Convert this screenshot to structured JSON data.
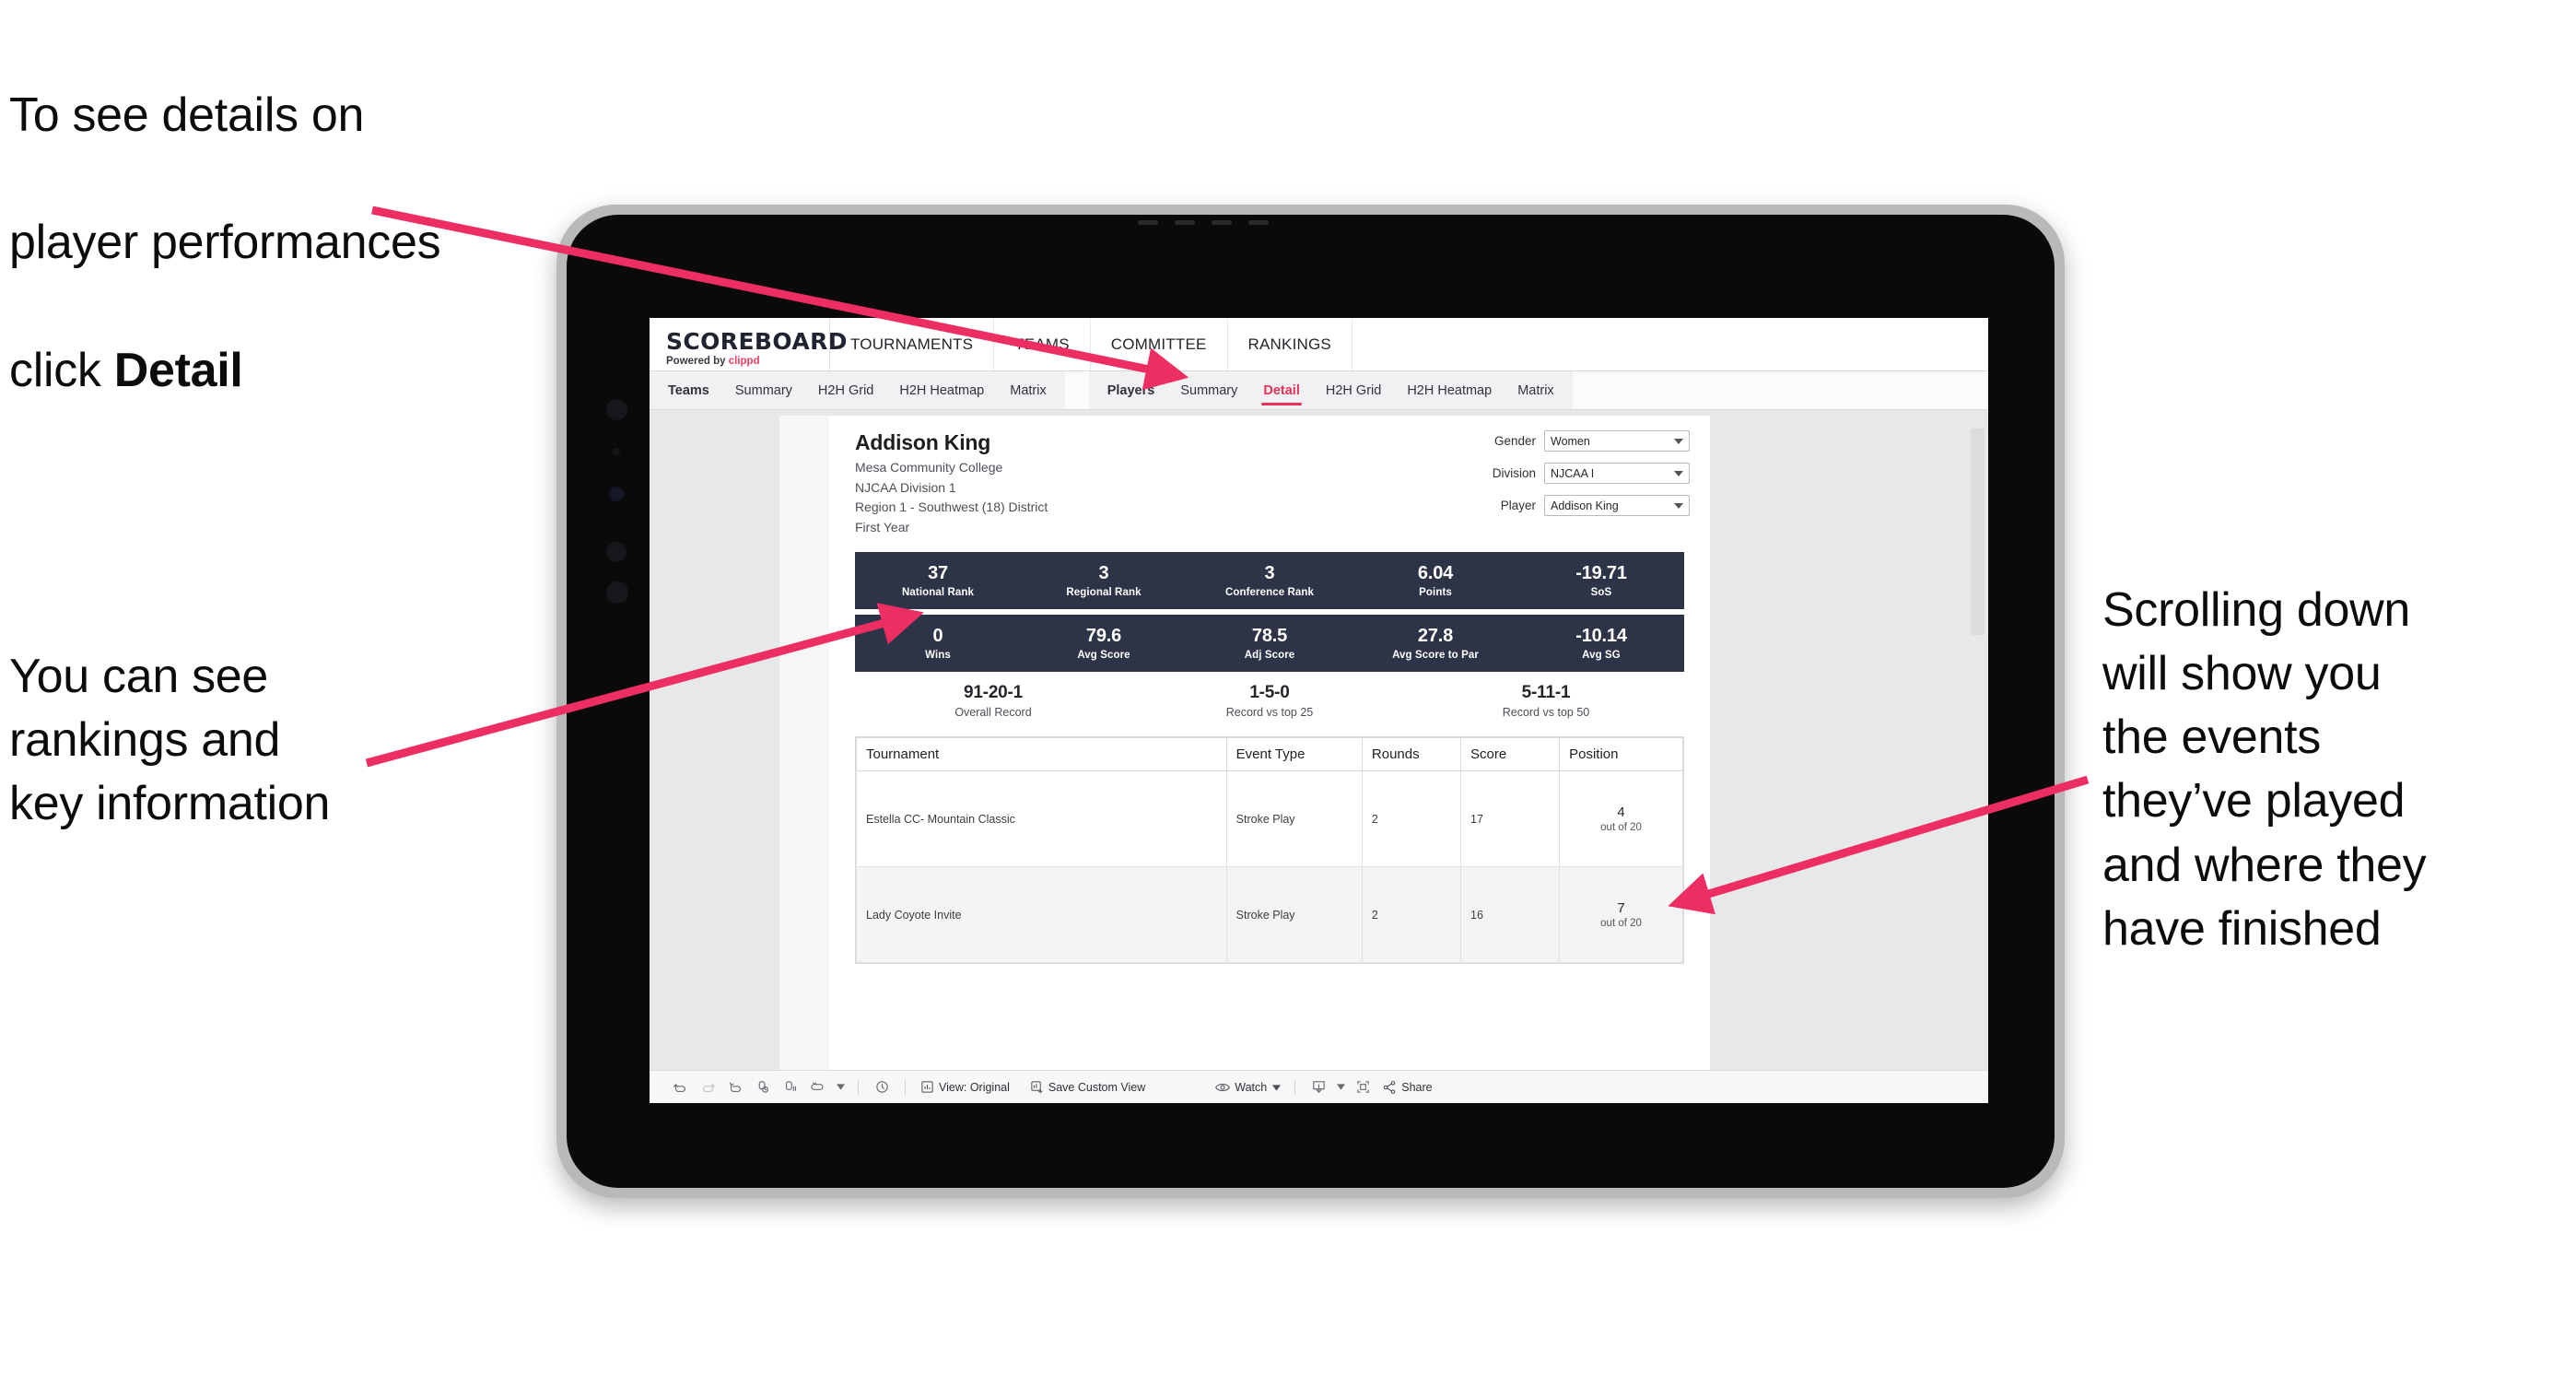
{
  "annotations": {
    "detail_line1": "To see details on",
    "detail_line2": "player performances",
    "detail_line3_prefix": "click ",
    "detail_line3_bold": "Detail",
    "ranking": "You can see\nrankings and\nkey information",
    "scrolling": "Scrolling down\nwill show you\nthe events\nthey’ve played\nand where they\nhave finished"
  },
  "app": {
    "logo_main": "SCOREBOARD",
    "logo_sub_prefix": "Powered by ",
    "logo_sub_brand": "clippd",
    "top_nav": [
      "TOURNAMENTS",
      "TEAMS",
      "COMMITTEE",
      "RANKINGS"
    ],
    "subnav_teams_group": [
      "Teams",
      "Summary",
      "H2H Grid",
      "H2H Heatmap",
      "Matrix"
    ],
    "subnav_players_group": [
      "Players",
      "Summary",
      "Detail",
      "H2H Grid",
      "H2H Heatmap",
      "Matrix"
    ],
    "active_subnav": "Detail"
  },
  "player": {
    "name": "Addison King",
    "college": "Mesa Community College",
    "division": "NJCAA Division 1",
    "region": "Region 1 - Southwest (18) District",
    "year": "First Year"
  },
  "filters": [
    {
      "label": "Gender",
      "value": "Women"
    },
    {
      "label": "Division",
      "value": "NJCAA I"
    },
    {
      "label": "Player",
      "value": "Addison King"
    }
  ],
  "stats_band_1": [
    {
      "value": "37",
      "label": "National Rank"
    },
    {
      "value": "3",
      "label": "Regional Rank"
    },
    {
      "value": "3",
      "label": "Conference Rank"
    },
    {
      "value": "6.04",
      "label": "Points"
    },
    {
      "value": "-19.71",
      "label": "SoS"
    }
  ],
  "stats_band_2": [
    {
      "value": "0",
      "label": "Wins"
    },
    {
      "value": "79.6",
      "label": "Avg Score"
    },
    {
      "value": "78.5",
      "label": "Adj Score"
    },
    {
      "value": "27.8",
      "label": "Avg Score to Par"
    },
    {
      "value": "-10.14",
      "label": "Avg SG"
    }
  ],
  "records": [
    {
      "value": "91-20-1",
      "label": "Overall Record"
    },
    {
      "value": "1-5-0",
      "label": "Record vs top 25"
    },
    {
      "value": "5-11-1",
      "label": "Record vs top 50"
    }
  ],
  "table": {
    "headers": [
      "Tournament",
      "Event Type",
      "Rounds",
      "Score",
      "Position"
    ],
    "rows": [
      {
        "tournament": "Estella CC- Mountain Classic",
        "event_type": "Stroke Play",
        "rounds": "2",
        "score": "17",
        "position": "4",
        "position_of": "out of 20"
      },
      {
        "tournament": "Lady Coyote Invite",
        "event_type": "Stroke Play",
        "rounds": "2",
        "score": "16",
        "position": "7",
        "position_of": "out of 20"
      }
    ]
  },
  "toolbar": {
    "view_label": "View: Original",
    "save_label": "Save Custom View",
    "watch_label": "Watch",
    "share_label": "Share"
  },
  "colors": {
    "accent_pink": "#e4335d",
    "band_navy": "#2e3447",
    "arrow_pink": "#ec २"
  }
}
